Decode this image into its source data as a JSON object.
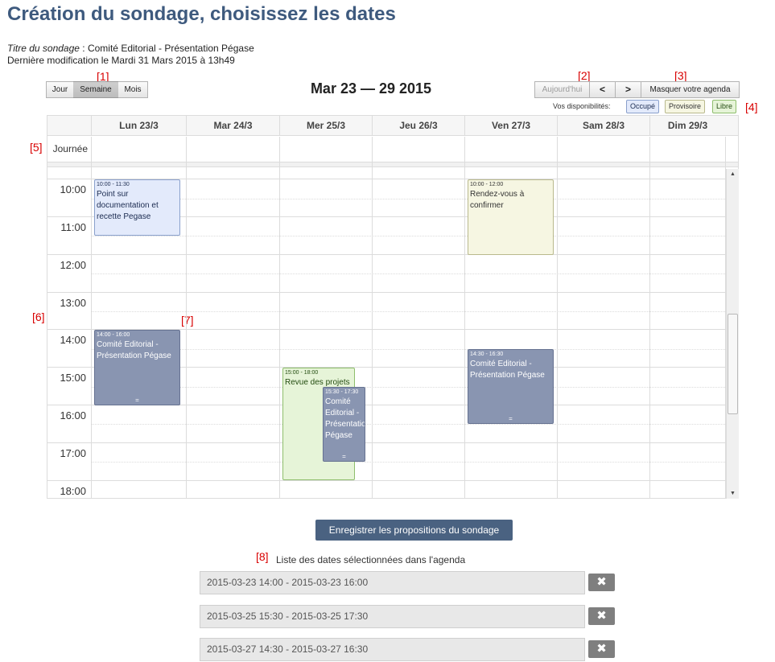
{
  "page": {
    "title": "Création du sondage, choisissez les dates",
    "poll_title_label": "Titre du sondage",
    "poll_title_sep": " : ",
    "poll_title_value": "Comité Editorial - Présentation Pégase",
    "last_modified": "Dernière modification le Mardi 31 Mars 2015 à 13h49"
  },
  "markers": [
    "[1]",
    "[2]",
    "[3]",
    "[4]",
    "[5]",
    "[6]",
    "[7]",
    "[8]"
  ],
  "toolbar": {
    "views": [
      "Jour",
      "Semaine",
      "Mois"
    ],
    "active_view": "Semaine",
    "range_title": "Mar 23 — 29 2015",
    "today_label": "Aujourd'hui",
    "prev_label": "<",
    "next_label": ">",
    "hide_agenda_label": "Masquer votre agenda"
  },
  "availability": {
    "label": "Vos disponibilités:",
    "items": [
      {
        "label": "Occupé",
        "bg": "#e3eafb",
        "border": "#8aa0cc",
        "color": "#1b2b50"
      },
      {
        "label": "Provisoire",
        "bg": "#f6f6e2",
        "border": "#b9b98d",
        "color": "#333333"
      },
      {
        "label": "Libre",
        "bg": "#e6f4d8",
        "border": "#8ebe6c",
        "color": "#234c10"
      }
    ]
  },
  "calendar": {
    "days": [
      "Lun 23/3",
      "Mar 24/3",
      "Mer 25/3",
      "Jeu 26/3",
      "Ven 27/3",
      "Sam 28/3",
      "Dim 29/3"
    ],
    "allday_label": "Journée",
    "hours": [
      "10:00",
      "11:00",
      "12:00",
      "13:00",
      "14:00",
      "15:00",
      "16:00",
      "17:00",
      "18:00"
    ],
    "events": [
      {
        "day": 0,
        "start": 10.0,
        "end": 11.5,
        "time": "10:00 - 11:30",
        "title": "Point sur documentation et recette Pegase",
        "kind": "occupe"
      },
      {
        "day": 4,
        "start": 10.0,
        "end": 12.0,
        "time": "10:00 - 12:00",
        "title": "Rendez-vous à confirmer",
        "kind": "provisoire"
      },
      {
        "day": 0,
        "start": 14.0,
        "end": 16.0,
        "time": "14:00 - 16:00",
        "title": "Comité Editorial - Présentation Pégase",
        "kind": "selected",
        "resize": "="
      },
      {
        "day": 2,
        "start": 15.0,
        "end": 18.0,
        "time": "15:00 - 18:00",
        "title": "Revue des projets",
        "kind": "libre"
      },
      {
        "day": 2,
        "start": 15.5,
        "end": 17.5,
        "time": "15:30 - 17:30",
        "title": "Comité Editorial - Présentation Pégase",
        "kind": "selected",
        "resize": "=",
        "overlap": true
      },
      {
        "day": 4,
        "start": 14.5,
        "end": 16.5,
        "time": "14:30 - 16:30",
        "title": "Comité Editorial - Présentation Pégase",
        "kind": "selected",
        "resize": "="
      }
    ]
  },
  "actions": {
    "save_label": "Enregistrer les propositions du sondage",
    "list_title": "Liste des dates sélectionnées dans l'agenda",
    "remove_label": "✖"
  },
  "selected_dates": [
    "2015-03-23 14:00 - 2015-03-23 16:00",
    "2015-03-25 15:30 - 2015-03-25 17:30",
    "2015-03-27 14:30 - 2015-03-27 16:30"
  ]
}
